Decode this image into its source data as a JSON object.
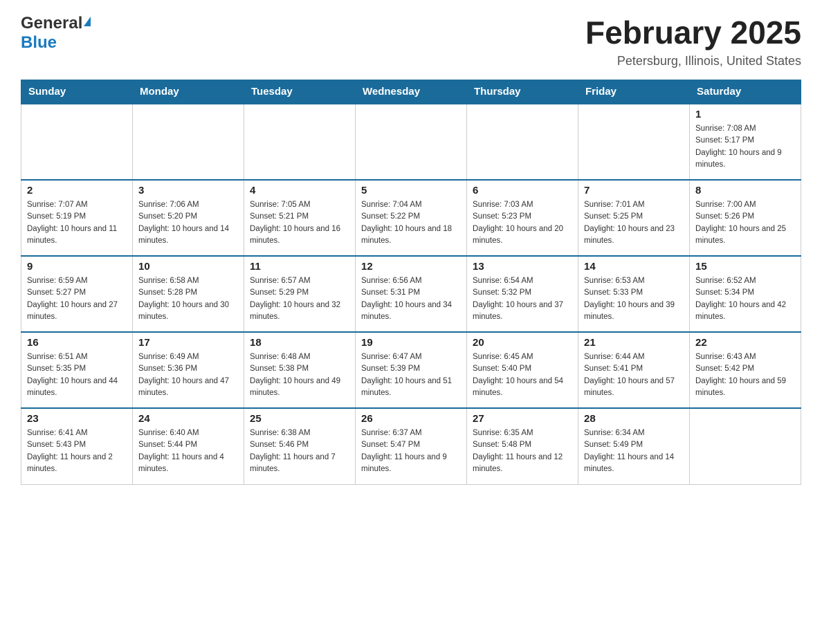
{
  "header": {
    "logo_general": "General",
    "logo_blue": "Blue",
    "month_title": "February 2025",
    "location": "Petersburg, Illinois, United States"
  },
  "weekdays": [
    "Sunday",
    "Monday",
    "Tuesday",
    "Wednesday",
    "Thursday",
    "Friday",
    "Saturday"
  ],
  "weeks": [
    [
      {
        "day": "",
        "sunrise": "",
        "sunset": "",
        "daylight": ""
      },
      {
        "day": "",
        "sunrise": "",
        "sunset": "",
        "daylight": ""
      },
      {
        "day": "",
        "sunrise": "",
        "sunset": "",
        "daylight": ""
      },
      {
        "day": "",
        "sunrise": "",
        "sunset": "",
        "daylight": ""
      },
      {
        "day": "",
        "sunrise": "",
        "sunset": "",
        "daylight": ""
      },
      {
        "day": "",
        "sunrise": "",
        "sunset": "",
        "daylight": ""
      },
      {
        "day": "1",
        "sunrise": "Sunrise: 7:08 AM",
        "sunset": "Sunset: 5:17 PM",
        "daylight": "Daylight: 10 hours and 9 minutes."
      }
    ],
    [
      {
        "day": "2",
        "sunrise": "Sunrise: 7:07 AM",
        "sunset": "Sunset: 5:19 PM",
        "daylight": "Daylight: 10 hours and 11 minutes."
      },
      {
        "day": "3",
        "sunrise": "Sunrise: 7:06 AM",
        "sunset": "Sunset: 5:20 PM",
        "daylight": "Daylight: 10 hours and 14 minutes."
      },
      {
        "day": "4",
        "sunrise": "Sunrise: 7:05 AM",
        "sunset": "Sunset: 5:21 PM",
        "daylight": "Daylight: 10 hours and 16 minutes."
      },
      {
        "day": "5",
        "sunrise": "Sunrise: 7:04 AM",
        "sunset": "Sunset: 5:22 PM",
        "daylight": "Daylight: 10 hours and 18 minutes."
      },
      {
        "day": "6",
        "sunrise": "Sunrise: 7:03 AM",
        "sunset": "Sunset: 5:23 PM",
        "daylight": "Daylight: 10 hours and 20 minutes."
      },
      {
        "day": "7",
        "sunrise": "Sunrise: 7:01 AM",
        "sunset": "Sunset: 5:25 PM",
        "daylight": "Daylight: 10 hours and 23 minutes."
      },
      {
        "day": "8",
        "sunrise": "Sunrise: 7:00 AM",
        "sunset": "Sunset: 5:26 PM",
        "daylight": "Daylight: 10 hours and 25 minutes."
      }
    ],
    [
      {
        "day": "9",
        "sunrise": "Sunrise: 6:59 AM",
        "sunset": "Sunset: 5:27 PM",
        "daylight": "Daylight: 10 hours and 27 minutes."
      },
      {
        "day": "10",
        "sunrise": "Sunrise: 6:58 AM",
        "sunset": "Sunset: 5:28 PM",
        "daylight": "Daylight: 10 hours and 30 minutes."
      },
      {
        "day": "11",
        "sunrise": "Sunrise: 6:57 AM",
        "sunset": "Sunset: 5:29 PM",
        "daylight": "Daylight: 10 hours and 32 minutes."
      },
      {
        "day": "12",
        "sunrise": "Sunrise: 6:56 AM",
        "sunset": "Sunset: 5:31 PM",
        "daylight": "Daylight: 10 hours and 34 minutes."
      },
      {
        "day": "13",
        "sunrise": "Sunrise: 6:54 AM",
        "sunset": "Sunset: 5:32 PM",
        "daylight": "Daylight: 10 hours and 37 minutes."
      },
      {
        "day": "14",
        "sunrise": "Sunrise: 6:53 AM",
        "sunset": "Sunset: 5:33 PM",
        "daylight": "Daylight: 10 hours and 39 minutes."
      },
      {
        "day": "15",
        "sunrise": "Sunrise: 6:52 AM",
        "sunset": "Sunset: 5:34 PM",
        "daylight": "Daylight: 10 hours and 42 minutes."
      }
    ],
    [
      {
        "day": "16",
        "sunrise": "Sunrise: 6:51 AM",
        "sunset": "Sunset: 5:35 PM",
        "daylight": "Daylight: 10 hours and 44 minutes."
      },
      {
        "day": "17",
        "sunrise": "Sunrise: 6:49 AM",
        "sunset": "Sunset: 5:36 PM",
        "daylight": "Daylight: 10 hours and 47 minutes."
      },
      {
        "day": "18",
        "sunrise": "Sunrise: 6:48 AM",
        "sunset": "Sunset: 5:38 PM",
        "daylight": "Daylight: 10 hours and 49 minutes."
      },
      {
        "day": "19",
        "sunrise": "Sunrise: 6:47 AM",
        "sunset": "Sunset: 5:39 PM",
        "daylight": "Daylight: 10 hours and 51 minutes."
      },
      {
        "day": "20",
        "sunrise": "Sunrise: 6:45 AM",
        "sunset": "Sunset: 5:40 PM",
        "daylight": "Daylight: 10 hours and 54 minutes."
      },
      {
        "day": "21",
        "sunrise": "Sunrise: 6:44 AM",
        "sunset": "Sunset: 5:41 PM",
        "daylight": "Daylight: 10 hours and 57 minutes."
      },
      {
        "day": "22",
        "sunrise": "Sunrise: 6:43 AM",
        "sunset": "Sunset: 5:42 PM",
        "daylight": "Daylight: 10 hours and 59 minutes."
      }
    ],
    [
      {
        "day": "23",
        "sunrise": "Sunrise: 6:41 AM",
        "sunset": "Sunset: 5:43 PM",
        "daylight": "Daylight: 11 hours and 2 minutes."
      },
      {
        "day": "24",
        "sunrise": "Sunrise: 6:40 AM",
        "sunset": "Sunset: 5:44 PM",
        "daylight": "Daylight: 11 hours and 4 minutes."
      },
      {
        "day": "25",
        "sunrise": "Sunrise: 6:38 AM",
        "sunset": "Sunset: 5:46 PM",
        "daylight": "Daylight: 11 hours and 7 minutes."
      },
      {
        "day": "26",
        "sunrise": "Sunrise: 6:37 AM",
        "sunset": "Sunset: 5:47 PM",
        "daylight": "Daylight: 11 hours and 9 minutes."
      },
      {
        "day": "27",
        "sunrise": "Sunrise: 6:35 AM",
        "sunset": "Sunset: 5:48 PM",
        "daylight": "Daylight: 11 hours and 12 minutes."
      },
      {
        "day": "28",
        "sunrise": "Sunrise: 6:34 AM",
        "sunset": "Sunset: 5:49 PM",
        "daylight": "Daylight: 11 hours and 14 minutes."
      },
      {
        "day": "",
        "sunrise": "",
        "sunset": "",
        "daylight": ""
      }
    ]
  ]
}
